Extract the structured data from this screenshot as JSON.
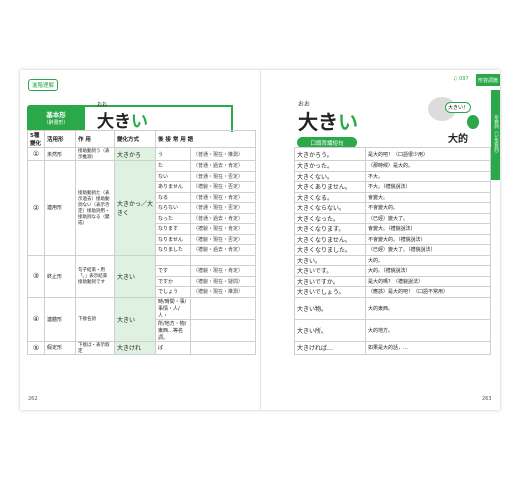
{
  "tag_left": "進階理解",
  "page_icon_label": "097",
  "tab_right": "形容詞篇",
  "side_strip": "形容詞（い形容詞）",
  "base_form": {
    "title": "基本形",
    "subtitle": "（辭書形）",
    "ruby": "おお",
    "stem": "大き",
    "ending": "い"
  },
  "right_word": {
    "ruby": "おお",
    "stem": "大き",
    "ending": "い"
  },
  "pill": "口頭背誦短句",
  "bubble": "大きい！",
  "zh_title": "大的",
  "headers": [
    "5種變化",
    "活用形",
    "作 用",
    "變化方式",
    "後 接 常 用 語"
  ],
  "rows": [
    {
      "num": "①",
      "form": "未然形",
      "use": "接助動詞う（表示推測）",
      "change": "大きかろ",
      "lines": [
        {
          "suffix": "う",
          "note": "（普通・現在・推測）",
          "sentence": "大きかろう。",
          "tr": "是大的吧！（口語很少用）"
        }
      ]
    },
    {
      "num": "②",
      "form": "連用形",
      "use": "接助動詞た（表示過去）接助動詞ない（表示否定）接助詞用・接助詞なる（變成）",
      "change": "大きかっ／大きく",
      "lines": [
        {
          "suffix": "た",
          "note": "（普通・過去・肯定）",
          "sentence": "大きかった。",
          "tr": "（那時候）是大的。"
        },
        {
          "suffix": "ない",
          "note": "（普通・現在・否定）",
          "sentence": "大きくない。",
          "tr": "不大。"
        },
        {
          "suffix": "ありません",
          "note": "（禮貌・現在・否定）",
          "sentence": "大きくありません。",
          "tr": "不大。（禮貌說法）"
        },
        {
          "suffix": "なる",
          "note": "（普通・現在・肯定）",
          "sentence": "大きくなる。",
          "tr": "會變大。"
        },
        {
          "suffix": "ならない",
          "note": "（普通・現在・否定）",
          "sentence": "大きくならない。",
          "tr": "不會變大的。"
        },
        {
          "suffix": "なった",
          "note": "（普通・過去・肯定）",
          "sentence": "大きくなった。",
          "tr": "（已經）變大了。"
        },
        {
          "suffix": "なります",
          "note": "（禮貌・現在・肯定）",
          "sentence": "大きくなります。",
          "tr": "會變大。（禮貌說法）"
        },
        {
          "suffix": "なりません",
          "note": "（禮貌・現在・否定）",
          "sentence": "大きくなりません。",
          "tr": "不會變大的。（禮貌說法）"
        },
        {
          "suffix": "なりました",
          "note": "（禮貌・過去・肯定）",
          "sentence": "大きくなりました。",
          "tr": "（已經）變大了。（禮貌說法）"
        }
      ]
    },
    {
      "num": "③",
      "form": "終止形",
      "use": "句子結束・用「。」表示結束 接助動詞です",
      "change": "大きい",
      "lines": [
        {
          "suffix": "",
          "note": "",
          "sentence": "大きい。",
          "tr": "大的。"
        },
        {
          "suffix": "です",
          "note": "（禮貌・現在・肯定）",
          "sentence": "大きいです。",
          "tr": "大的。（禮貌說法）"
        },
        {
          "suffix": "ですか",
          "note": "（禮貌・現在・疑問）",
          "sentence": "大きいですか。",
          "tr": "是大的嗎？（禮貌說法）"
        },
        {
          "suffix": "でしょう",
          "note": "（禮貌・現在・推測）",
          "sentence": "大きいでしょう。",
          "tr": "（應該）是大的吧！（口語不常用）"
        }
      ]
    },
    {
      "num": "④",
      "form": "連體形",
      "use": "下接名詞",
      "change": "大きい",
      "lines": [
        {
          "suffix": "時/時間・事/事情・人/人・",
          "note": "",
          "sentence": "大きい物。",
          "tr": "大的東西。"
        },
        {
          "suffix": "所/地方・物/東西…等名詞。",
          "note": "",
          "sentence": "大きい所。",
          "tr": "大的地方。"
        }
      ]
    },
    {
      "num": "⑤",
      "form": "假定形",
      "use": "下接ば・表示假定",
      "change": "大きけれ",
      "lines": [
        {
          "suffix": "ば",
          "note": "",
          "sentence": "大きければ…",
          "tr": "如果是大的話，…"
        }
      ]
    }
  ],
  "page_left": "262",
  "page_right": "263"
}
